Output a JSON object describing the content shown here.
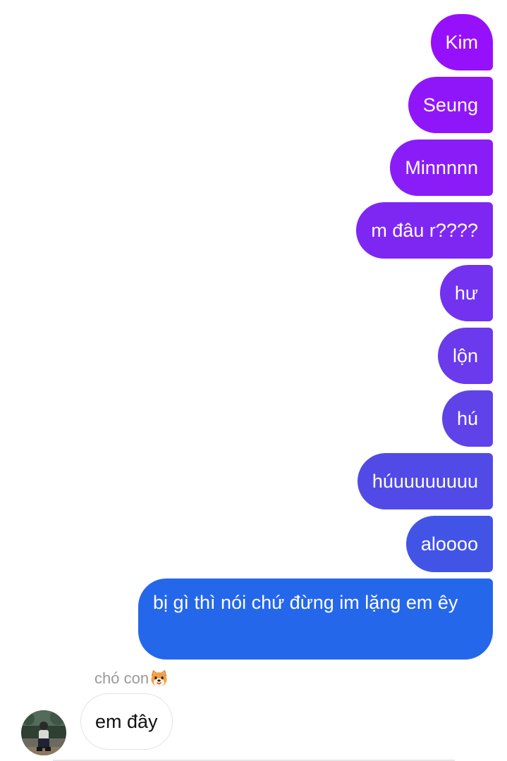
{
  "messages_out": [
    {
      "text": "Kim",
      "color": "#9610fb"
    },
    {
      "text": "Seung",
      "color": "#9016fa"
    },
    {
      "text": "Minnnnn",
      "color": "#8a1cf8"
    },
    {
      "text": "m đâu r????",
      "color": "#7e27f3"
    },
    {
      "text": "hư",
      "color": "#7232ef"
    },
    {
      "text": "lộn",
      "color": "#6a3aec"
    },
    {
      "text": "hú",
      "color": "#6042e9"
    },
    {
      "text": "húuuuuuuuu",
      "color": "#524ae7"
    },
    {
      "text": "aloooo",
      "color": "#4254e6"
    },
    {
      "text": "bị gì thì nói chứ đừng im lặng em êy",
      "color": "#2567ea"
    }
  ],
  "contact": {
    "name": "chó con",
    "emoji_icon": "dog-face-emoji"
  },
  "messages_in": [
    {
      "text": "em đây"
    }
  ]
}
